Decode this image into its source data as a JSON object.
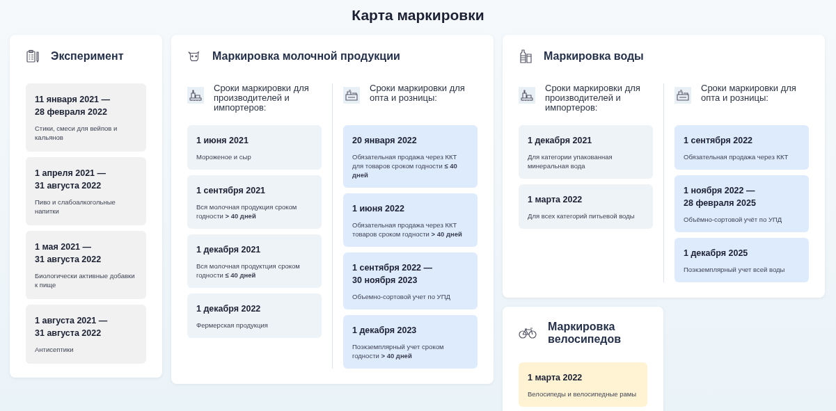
{
  "title": "Карта маркировки",
  "experiment": {
    "title": "Эксперимент",
    "items": [
      {
        "date": "11 января 2021 —\n28 февраля 2022",
        "text": "Стики, смеси для вейпов и кальянов"
      },
      {
        "date": "1 апреля 2021 —\n31 августа 2022",
        "text": "Пиво и слабоалкогольные напитки"
      },
      {
        "date": "1 мая 2021 —\n31 августа 2022",
        "text": "Биологически активные добавки к пище"
      },
      {
        "date": "1 августа 2021 —\n31 августа 2022",
        "text": "Антисептики"
      }
    ]
  },
  "groups": [
    {
      "title": "Маркировка молочной продукции",
      "columns": [
        {
          "kind": "producer",
          "heading": "Сроки маркировки для производителей и импортеров:",
          "items": [
            {
              "date": "1 июня 2021",
              "text": "Мороженое и сыр"
            },
            {
              "date": "1 сентября 2021",
              "text": "Вся молочная продукция сроком годности **> 40 дней**"
            },
            {
              "date": "1 декабря 2021",
              "text": "Вся молочная продуктция сроком годности **≤ 40 дней**"
            },
            {
              "date": "1 декабря 2022",
              "text": "Фермерская продукция"
            }
          ]
        },
        {
          "kind": "retail",
          "heading": "Сроки маркировки для опта и розницы:",
          "items": [
            {
              "date": "20 января 2022",
              "text": "Обязательная продажа через ККТ для товаров сроком годности **≤ 40 дней**"
            },
            {
              "date": "1 июня 2022",
              "text": "Обязательная продажа через ККТ товаров сроком годности **> 40 дней**"
            },
            {
              "date": "1 сентября 2022 —\n30 ноября 2023",
              "text": "Объемно-сортовой учет по УПД"
            },
            {
              "date": "1 декабря 2023",
              "text": "Поэкземплярный учет сроком годности **> 40 дней**"
            }
          ]
        }
      ]
    },
    {
      "title": "Маркировка воды",
      "columns": [
        {
          "kind": "producer",
          "heading": "Сроки маркировки для производителей и импортеров:",
          "items": [
            {
              "date": "1 декабря 2021",
              "text": "Для категории упакованная минеральная вода"
            },
            {
              "date": "1 марта 2022",
              "text": "Для всех категорий питьевой воды"
            }
          ]
        },
        {
          "kind": "retail",
          "heading": "Сроки маркировки для опта и розницы:",
          "items": [
            {
              "date": "1 сентября 2022",
              "text": "Обязательная продажа через ККТ"
            },
            {
              "date": "1 ноября 2022 —\n28 февраля 2025",
              "text": "Объёмно-сортовой учёт по УПД"
            },
            {
              "date": "1 декабря 2025",
              "text": "Поэкземплярный учет всей воды"
            }
          ]
        }
      ]
    }
  ],
  "bikes": {
    "title": "Маркировка велосипедов",
    "items": [
      {
        "date": "1 марта 2022",
        "text": "Велосипеды и велосипедные рамы"
      }
    ]
  }
}
